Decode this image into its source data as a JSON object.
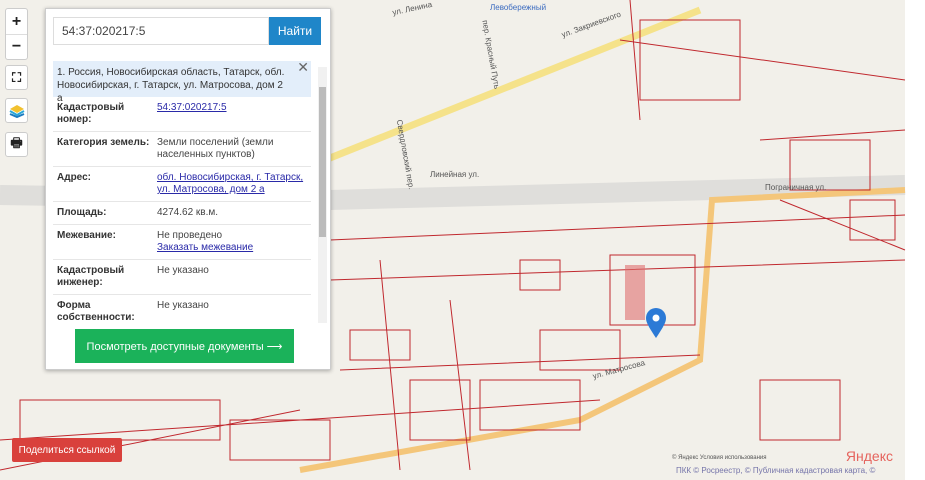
{
  "search": {
    "value": "54:37:020217:5",
    "button": "Найти"
  },
  "info": {
    "header": "1. Россия, Новосибирская область, Татарск, обл. Новосибирская, г. Татарск, ул. Матросова, дом 2 а",
    "rows": [
      {
        "key": "Кадастровый номер:",
        "value": "54:37:020217:5"
      },
      {
        "key": "Категория земель:",
        "value": "Земли поселений (земли населенных пунктов)"
      },
      {
        "key": "Адрес:",
        "value": "обл. Новосибирская, г. Татарск, ул. Матросова, дом 2 а"
      },
      {
        "key": "Площадь:",
        "value": "4274.62 кв.м."
      },
      {
        "key": "Межевание:",
        "value": "Не проведено",
        "link": "Заказать межевание"
      },
      {
        "key": "Кадастровый инженер:",
        "value": "Не указано"
      },
      {
        "key": "Форма собственности:",
        "value": "Не указано"
      }
    ]
  },
  "docs_button": "Посмотреть доступные документы ⟶",
  "share_button": "Поделиться ссылкой",
  "map": {
    "streets": [
      "ул. Ленина",
      "пер. Красный Путь",
      "ул. Закриевского",
      "Свердловский пер.",
      "Линейная ул.",
      "Пограничная ул.",
      "ул. Матросова",
      "Левобережный"
    ],
    "copyright": "© Яндекс  Условия использования",
    "attribution": "ПКК © Росреестр, © Публичная кадастровая карта, ©",
    "logo": "Яндекс"
  }
}
